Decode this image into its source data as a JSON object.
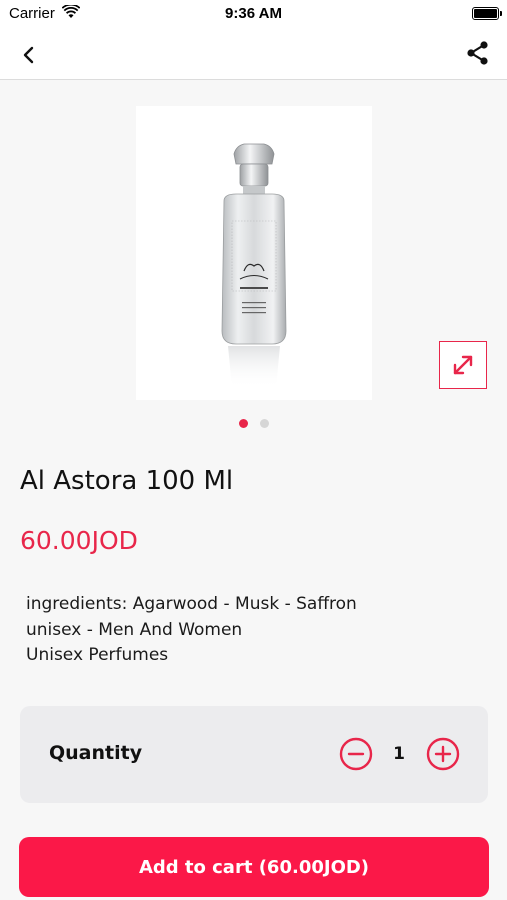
{
  "status_bar": {
    "carrier": "Carrier",
    "time": "9:36 AM"
  },
  "nav": {
    "back_icon": "chevron-left-icon",
    "share_icon": "share-icon"
  },
  "product": {
    "title": "Al Astora 100 Ml",
    "price": "60.00JOD",
    "image_count": 2,
    "active_image": 1,
    "description": [
      "ingredients: Agarwood - Musk - Saffron",
      "unisex - Men And Women",
      "Unisex Perfumes"
    ]
  },
  "quantity": {
    "label": "Quantity",
    "value": "1"
  },
  "cart": {
    "add_label": "Add to cart (60.00JOD)"
  },
  "colors": {
    "accent": "#e8264a",
    "button": "#fb1848",
    "background": "#f7f7f7"
  }
}
